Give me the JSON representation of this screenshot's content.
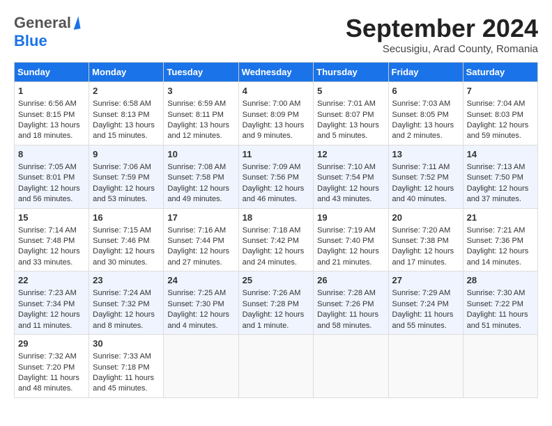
{
  "logo": {
    "general": "General",
    "blue": "Blue"
  },
  "title": "September 2024",
  "location": "Secusigiu, Arad County, Romania",
  "days": [
    "Sunday",
    "Monday",
    "Tuesday",
    "Wednesday",
    "Thursday",
    "Friday",
    "Saturday"
  ],
  "weeks": [
    [
      {
        "num": "1",
        "sunrise": "6:56 AM",
        "sunset": "8:15 PM",
        "daylight": "13 hours and 18 minutes."
      },
      {
        "num": "2",
        "sunrise": "6:58 AM",
        "sunset": "8:13 PM",
        "daylight": "13 hours and 15 minutes."
      },
      {
        "num": "3",
        "sunrise": "6:59 AM",
        "sunset": "8:11 PM",
        "daylight": "13 hours and 12 minutes."
      },
      {
        "num": "4",
        "sunrise": "7:00 AM",
        "sunset": "8:09 PM",
        "daylight": "13 hours and 9 minutes."
      },
      {
        "num": "5",
        "sunrise": "7:01 AM",
        "sunset": "8:07 PM",
        "daylight": "13 hours and 5 minutes."
      },
      {
        "num": "6",
        "sunrise": "7:03 AM",
        "sunset": "8:05 PM",
        "daylight": "13 hours and 2 minutes."
      },
      {
        "num": "7",
        "sunrise": "7:04 AM",
        "sunset": "8:03 PM",
        "daylight": "12 hours and 59 minutes."
      }
    ],
    [
      {
        "num": "8",
        "sunrise": "7:05 AM",
        "sunset": "8:01 PM",
        "daylight": "12 hours and 56 minutes."
      },
      {
        "num": "9",
        "sunrise": "7:06 AM",
        "sunset": "7:59 PM",
        "daylight": "12 hours and 53 minutes."
      },
      {
        "num": "10",
        "sunrise": "7:08 AM",
        "sunset": "7:58 PM",
        "daylight": "12 hours and 49 minutes."
      },
      {
        "num": "11",
        "sunrise": "7:09 AM",
        "sunset": "7:56 PM",
        "daylight": "12 hours and 46 minutes."
      },
      {
        "num": "12",
        "sunrise": "7:10 AM",
        "sunset": "7:54 PM",
        "daylight": "12 hours and 43 minutes."
      },
      {
        "num": "13",
        "sunrise": "7:11 AM",
        "sunset": "7:52 PM",
        "daylight": "12 hours and 40 minutes."
      },
      {
        "num": "14",
        "sunrise": "7:13 AM",
        "sunset": "7:50 PM",
        "daylight": "12 hours and 37 minutes."
      }
    ],
    [
      {
        "num": "15",
        "sunrise": "7:14 AM",
        "sunset": "7:48 PM",
        "daylight": "12 hours and 33 minutes."
      },
      {
        "num": "16",
        "sunrise": "7:15 AM",
        "sunset": "7:46 PM",
        "daylight": "12 hours and 30 minutes."
      },
      {
        "num": "17",
        "sunrise": "7:16 AM",
        "sunset": "7:44 PM",
        "daylight": "12 hours and 27 minutes."
      },
      {
        "num": "18",
        "sunrise": "7:18 AM",
        "sunset": "7:42 PM",
        "daylight": "12 hours and 24 minutes."
      },
      {
        "num": "19",
        "sunrise": "7:19 AM",
        "sunset": "7:40 PM",
        "daylight": "12 hours and 21 minutes."
      },
      {
        "num": "20",
        "sunrise": "7:20 AM",
        "sunset": "7:38 PM",
        "daylight": "12 hours and 17 minutes."
      },
      {
        "num": "21",
        "sunrise": "7:21 AM",
        "sunset": "7:36 PM",
        "daylight": "12 hours and 14 minutes."
      }
    ],
    [
      {
        "num": "22",
        "sunrise": "7:23 AM",
        "sunset": "7:34 PM",
        "daylight": "12 hours and 11 minutes."
      },
      {
        "num": "23",
        "sunrise": "7:24 AM",
        "sunset": "7:32 PM",
        "daylight": "12 hours and 8 minutes."
      },
      {
        "num": "24",
        "sunrise": "7:25 AM",
        "sunset": "7:30 PM",
        "daylight": "12 hours and 4 minutes."
      },
      {
        "num": "25",
        "sunrise": "7:26 AM",
        "sunset": "7:28 PM",
        "daylight": "12 hours and 1 minute."
      },
      {
        "num": "26",
        "sunrise": "7:28 AM",
        "sunset": "7:26 PM",
        "daylight": "11 hours and 58 minutes."
      },
      {
        "num": "27",
        "sunrise": "7:29 AM",
        "sunset": "7:24 PM",
        "daylight": "11 hours and 55 minutes."
      },
      {
        "num": "28",
        "sunrise": "7:30 AM",
        "sunset": "7:22 PM",
        "daylight": "11 hours and 51 minutes."
      }
    ],
    [
      {
        "num": "29",
        "sunrise": "7:32 AM",
        "sunset": "7:20 PM",
        "daylight": "11 hours and 48 minutes."
      },
      {
        "num": "30",
        "sunrise": "7:33 AM",
        "sunset": "7:18 PM",
        "daylight": "11 hours and 45 minutes."
      },
      null,
      null,
      null,
      null,
      null
    ]
  ]
}
